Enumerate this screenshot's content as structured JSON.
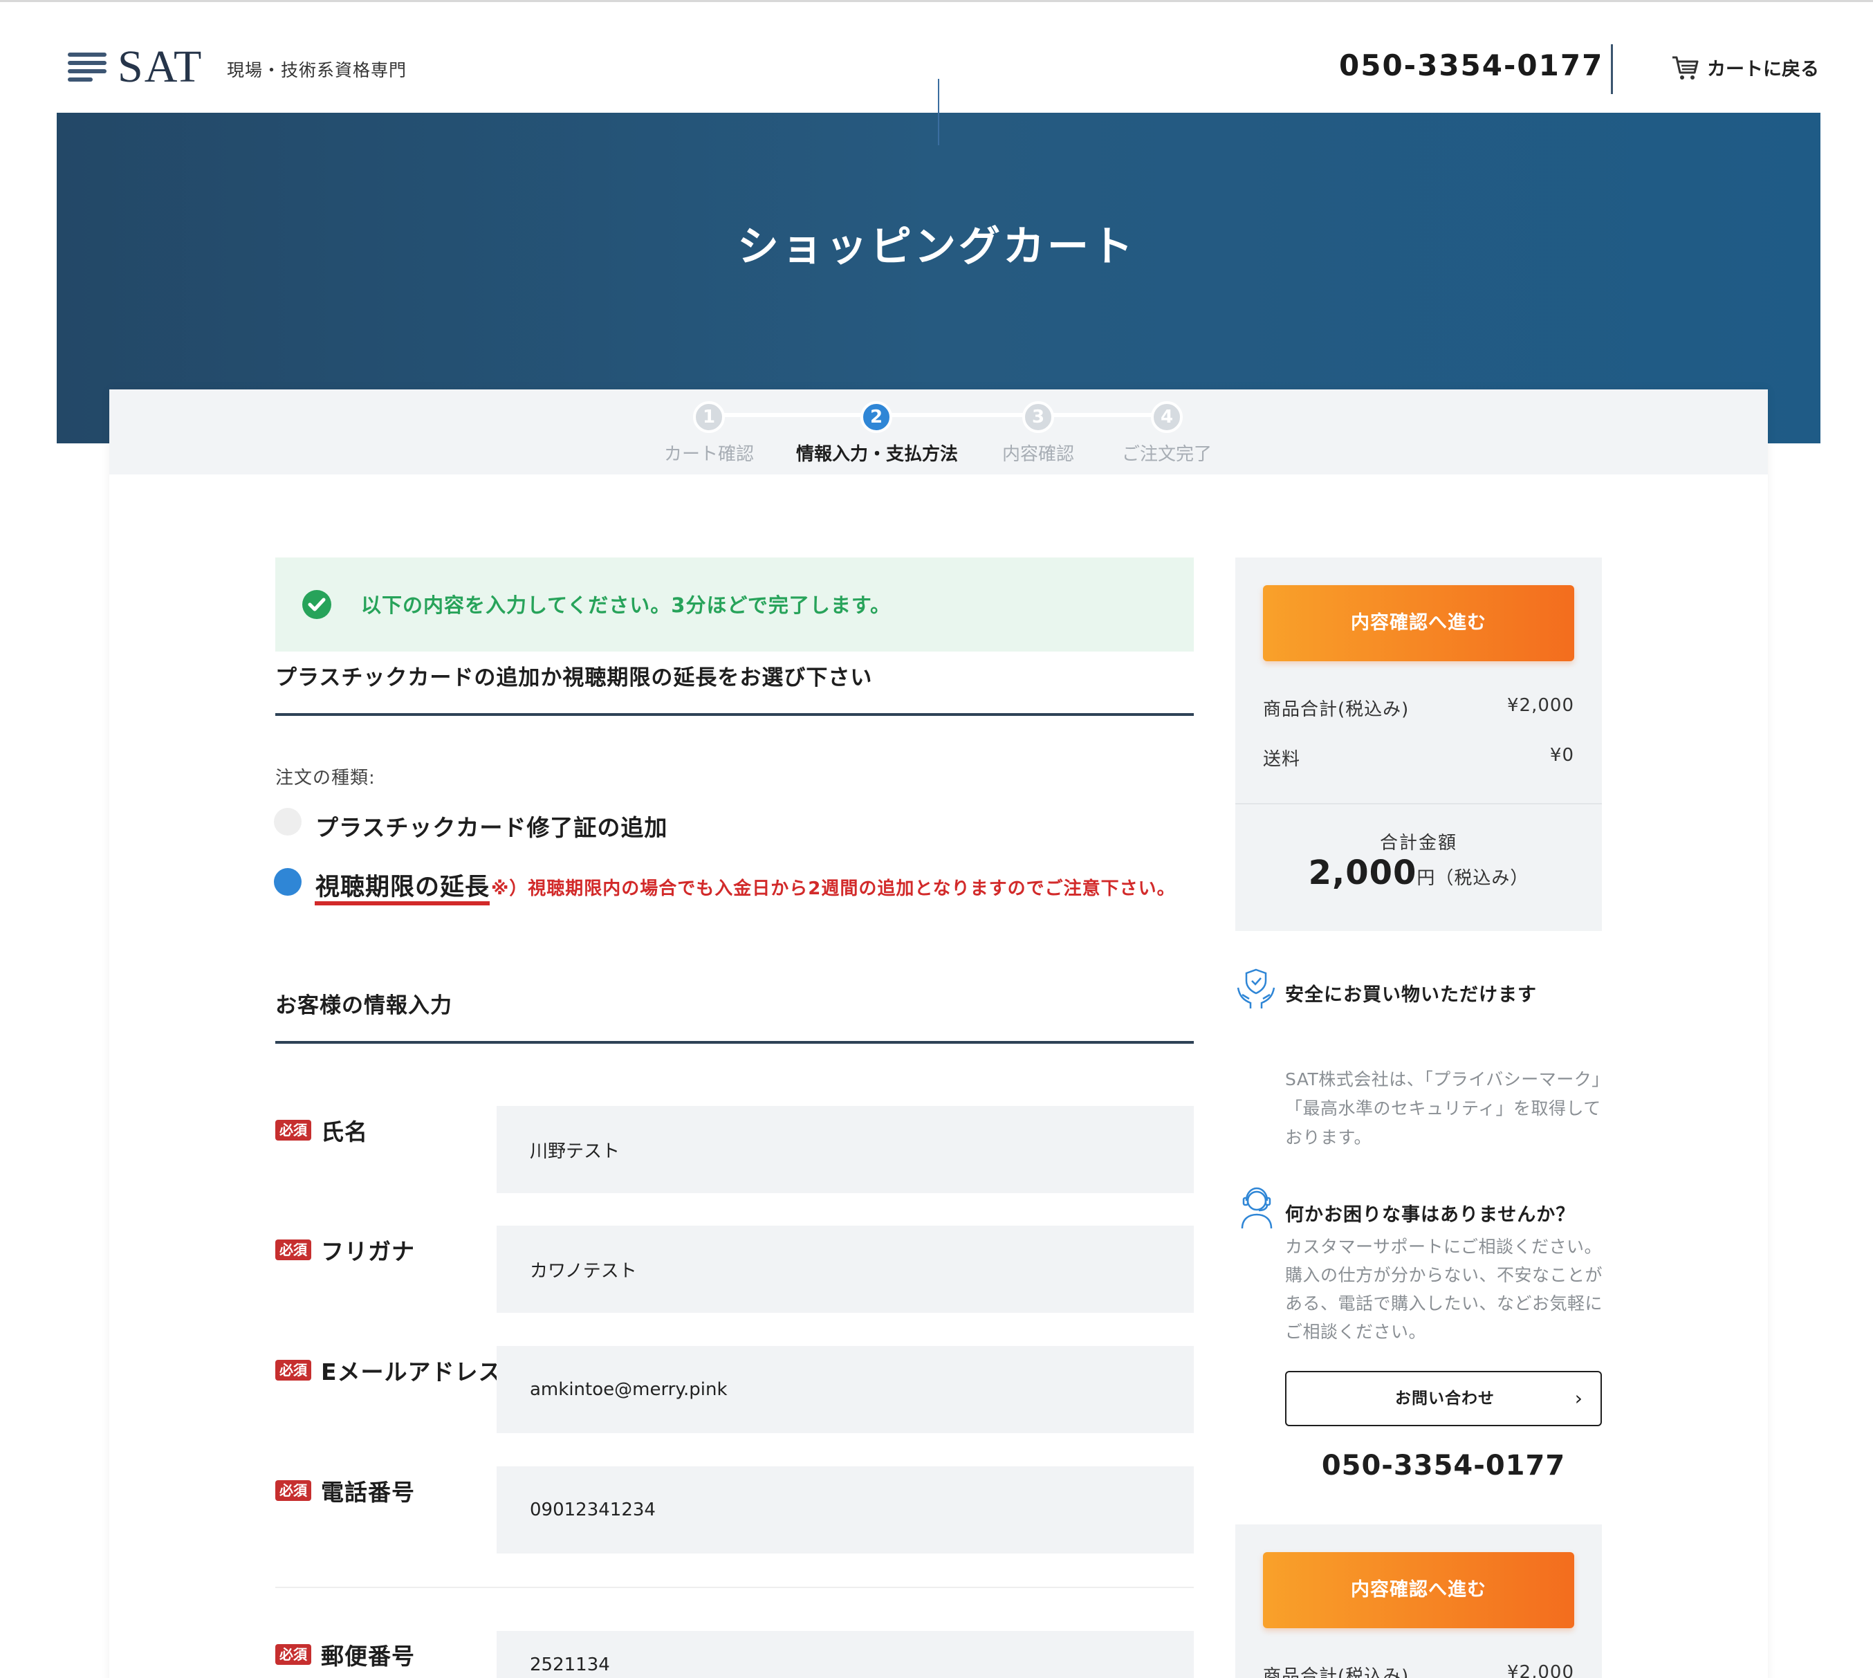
{
  "header": {
    "logo_text": "SAT",
    "logo_subtitle": "現場・技術系資格専門",
    "phone": "050-3354-0177",
    "back_to_cart": "カートに戻る"
  },
  "hero": {
    "title": "ショッピングカート"
  },
  "steps": [
    {
      "num": "1",
      "label": "カート確認",
      "active": false
    },
    {
      "num": "2",
      "label": "情報入力・支払方法",
      "active": true
    },
    {
      "num": "3",
      "label": "内容確認",
      "active": false
    },
    {
      "num": "4",
      "label": "ご注文完了",
      "active": false
    }
  ],
  "notice": {
    "text": "以下の内容を入力してください。3分ほどで完了します。"
  },
  "order": {
    "section_title": "プラスチックカードの追加か視聴期限の延長をお選び下さい",
    "type_label": "注文の種類:",
    "options": [
      {
        "label": "プラスチックカード修了証の追加",
        "selected": false
      },
      {
        "label": "視聴期限の延長",
        "selected": true
      }
    ],
    "note": "※）視聴期限内の場合でも入金日から2週間の追加となりますのでご注意下さい。"
  },
  "customer": {
    "section_title": "お客様の情報入力",
    "required_badge": "必須",
    "fields": [
      {
        "label": "氏名",
        "value": "川野テスト"
      },
      {
        "label": "フリガナ",
        "value": "カワノテスト"
      },
      {
        "label": "Eメールアドレス",
        "value": "amkintoe@merry.pink"
      },
      {
        "label": "電話番号",
        "value": "09012341234"
      },
      {
        "label": "郵便番号",
        "value": "2521134"
      }
    ]
  },
  "summary": {
    "proceed_button": "内容確認へ進む",
    "subtotal_label": "商品合計(税込み)",
    "subtotal_value": "¥2,000",
    "shipping_label": "送料",
    "shipping_value": "¥0",
    "total_label": "合計金額",
    "total_amount": "2,000",
    "total_suffix": "円（税込み）"
  },
  "sidebar": {
    "safe_title": "安全にお買い物いただけます",
    "safe_text": "SAT株式会社は、「プライバシーマーク」「最高水準のセキュリティ」を取得しております。",
    "help_title": "何かお困りな事はありませんか？",
    "help_text": "カスタマーサポートにご相談ください。購入の仕方が分からない、不安なことがある、電話で購入したい、などお気軽にご相談ください。",
    "contact_button": "お問い合わせ",
    "phone": "050-3354-0177"
  },
  "colors": {
    "hero_start": "#234867",
    "hero_end": "#1f5b86",
    "accent_orange": "#f36d1e",
    "accent_blue": "#2f86d6",
    "notice_green": "#27a35a",
    "required_red": "#c62f2f"
  }
}
